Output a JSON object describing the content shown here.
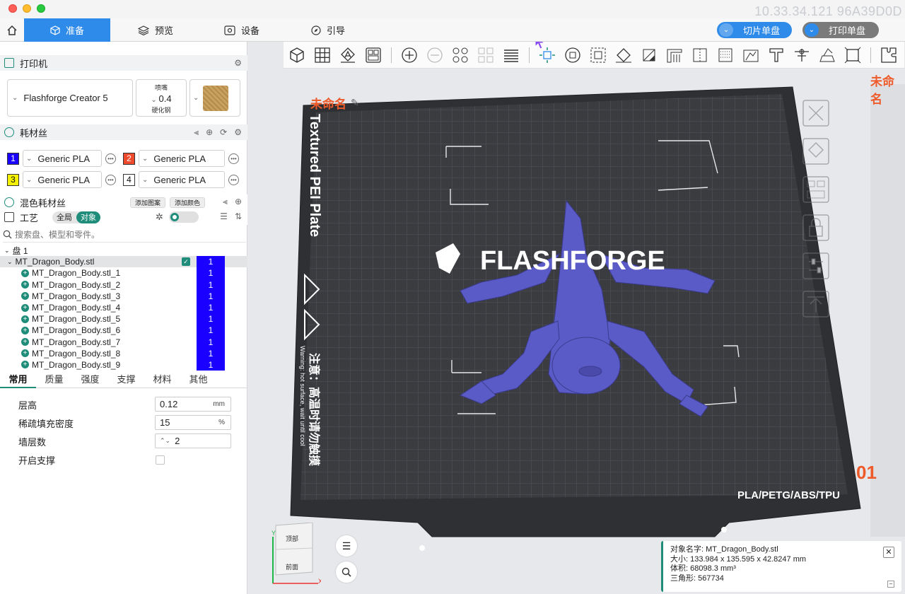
{
  "window": {
    "watermark": "10.33.34.121 96A39D0D"
  },
  "tabs": [
    {
      "label": "准备",
      "icon": "cube-icon"
    },
    {
      "label": "预览",
      "icon": "layers-icon"
    },
    {
      "label": "设备",
      "icon": "device-icon"
    },
    {
      "label": "引导",
      "icon": "compass-icon"
    }
  ],
  "actions": {
    "slice": "切片单盘",
    "print": "打印单盘"
  },
  "printer": {
    "section_title": "打印机",
    "name": "Flashforge Creator 5",
    "nozzle_label": "喷嘴",
    "nozzle_value": "0.4",
    "nozzle_material": "硬化钢"
  },
  "filament": {
    "section_title": "耗材丝",
    "slots": [
      {
        "num": "1",
        "color": "#1a00ff",
        "text_color": "#ffffff",
        "name": "Generic PLA"
      },
      {
        "num": "2",
        "color": "#ef4a2c",
        "text_color": "#ffffff",
        "name": "Generic PLA"
      },
      {
        "num": "3",
        "color": "#f3f100",
        "text_color": "#111111",
        "name": "Generic PLA"
      },
      {
        "num": "4",
        "color": "#ffffff",
        "text_color": "#111111",
        "name": "Generic PLA"
      }
    ],
    "mixed_title": "混色耗材丝",
    "add_pattern": "添加图案",
    "add_color": "添加颜色"
  },
  "process": {
    "section_title": "工艺",
    "toggle_global": "全局",
    "toggle_object": "对象"
  },
  "search": {
    "placeholder": "搜索盘、模型和零件。"
  },
  "tree": {
    "plate": "盘 1",
    "object": "MT_Dragon_Body.stl",
    "object_extruder": "1",
    "parts": [
      {
        "name": "MT_Dragon_Body.stl_1",
        "extruder": "1"
      },
      {
        "name": "MT_Dragon_Body.stl_2",
        "extruder": "1"
      },
      {
        "name": "MT_Dragon_Body.stl_3",
        "extruder": "1"
      },
      {
        "name": "MT_Dragon_Body.stl_4",
        "extruder": "1"
      },
      {
        "name": "MT_Dragon_Body.stl_5",
        "extruder": "1"
      },
      {
        "name": "MT_Dragon_Body.stl_6",
        "extruder": "1"
      },
      {
        "name": "MT_Dragon_Body.stl_7",
        "extruder": "1"
      },
      {
        "name": "MT_Dragon_Body.stl_8",
        "extruder": "1"
      },
      {
        "name": "MT_Dragon_Body.stl_9",
        "extruder": "1"
      }
    ]
  },
  "settings_tabs": [
    "常用",
    "质量",
    "强度",
    "支撑",
    "材料",
    "其他"
  ],
  "params": {
    "layer_height": {
      "label": "层高",
      "value": "0.12",
      "unit": "mm"
    },
    "infill": {
      "label": "稀疏填充密度",
      "value": "15",
      "unit": "%"
    },
    "walls": {
      "label": "墙层数",
      "value": "2"
    },
    "support": {
      "label": "开启支撑"
    }
  },
  "viewport": {
    "plate_name": "未命名",
    "plate_name_right": "未命名",
    "plate_number": "01",
    "plate_label": "Textured PEI Plate",
    "brand": "FLASHFORGE",
    "materials": "PLA/PETG/ABS/TPU",
    "warning_cn": "注意：高温时请勿触摸",
    "warning_en": "Warning: hot surface, wait until cool",
    "cube_top": "顶部",
    "cube_front": "前面"
  },
  "object_info": {
    "name_label": "对象名字:",
    "name": "MT_Dragon_Body.stl",
    "size_label": "大小:",
    "size": "133.984 x 135.595 x 42.8247 mm",
    "volume_label": "体积:",
    "volume": "68098.3 mm³",
    "triangles_label": "三角形:",
    "triangles": "567734"
  }
}
